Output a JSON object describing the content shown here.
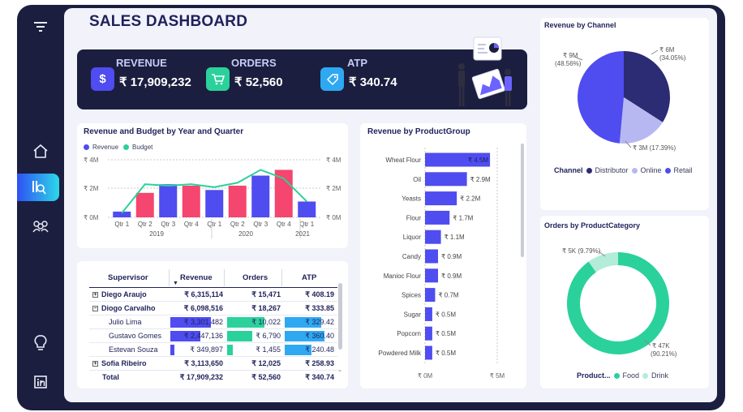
{
  "title": "SALES DASHBOARD",
  "sidebar": {
    "items": [
      {
        "name": "filter-icon",
        "glyph": "≡"
      },
      {
        "name": "home-icon",
        "glyph": "⌂"
      },
      {
        "name": "report-icon",
        "glyph": "▤"
      },
      {
        "name": "people-icon",
        "glyph": "⚇"
      },
      {
        "name": "lightbulb-icon",
        "glyph": "♁"
      },
      {
        "name": "linkedin-icon",
        "glyph": "in"
      }
    ]
  },
  "kpis": [
    {
      "label": "REVENUE",
      "value": "₹ 17,909,232",
      "icon": "dollar-icon",
      "glyph": "$",
      "color": "#4f4cf0"
    },
    {
      "label": "ORDERS",
      "value": "₹ 52,560",
      "icon": "cart-icon",
      "glyph": "🛒",
      "color": "#2bd19b"
    },
    {
      "label": "ATP",
      "value": "₹ 340.74",
      "icon": "tag-icon",
      "glyph": "%",
      "color": "#2fa8f2"
    }
  ],
  "colors": {
    "revenue_bar": "#4f4cf0",
    "revenue_bar_alt": "#f4466e",
    "budget_line": "#2bd19b",
    "distributor": "#2b2c73",
    "online": "#b7b8f2",
    "retail": "#4f4cf0",
    "food": "#2bd19b",
    "drink": "#b3ecd9",
    "atp_bar": "#2fa8f2"
  },
  "revenue_budget": {
    "title": "Revenue and Budget by Year and Quarter",
    "legend": [
      "Revenue",
      "Budget"
    ],
    "left_ticks": [
      "₹ 4M",
      "₹ 2M",
      "₹ 0M"
    ],
    "right_ticks": [
      "₹ 4M",
      "₹ 2M",
      "₹ 0M"
    ],
    "years": [
      "2019",
      "2020",
      "2021"
    ]
  },
  "chart_data": [
    {
      "type": "bar",
      "title": "Revenue and Budget by Year and Quarter",
      "categories": [
        "Qtr 1",
        "Qtr 2",
        "Qtr 3",
        "Qtr 4",
        "Qtr 1",
        "Qtr 2",
        "Qtr 3",
        "Qtr 4",
        "Qtr 1"
      ],
      "groups": [
        "2019",
        "2019",
        "2019",
        "2019",
        "2020",
        "2020",
        "2020",
        "2020",
        "2021"
      ],
      "series": [
        {
          "name": "Revenue",
          "values": [
            0.4,
            1.7,
            2.3,
            2.2,
            1.9,
            2.2,
            2.9,
            3.3,
            1.1
          ]
        },
        {
          "name": "Budget",
          "values": [
            0.3,
            2.3,
            2.2,
            2.3,
            2.1,
            2.4,
            3.3,
            2.7,
            1.1
          ]
        }
      ],
      "ylim": [
        0,
        4
      ],
      "y_unit": "₹ M"
    },
    {
      "type": "bar",
      "title": "Revenue by ProductGroup",
      "categories": [
        "Wheat Flour",
        "Oil",
        "Yeasts",
        "Flour",
        "Liquor",
        "Candy",
        "Manioc Flour",
        "Spices",
        "Sugar",
        "Popcorn",
        "Powdered Milk"
      ],
      "values": [
        4.5,
        2.9,
        2.2,
        1.7,
        1.1,
        0.9,
        0.9,
        0.7,
        0.5,
        0.5,
        0.5
      ],
      "value_labels": [
        "₹ 4.5M",
        "₹ 2.9M",
        "₹ 2.2M",
        "₹ 1.7M",
        "₹ 1.1M",
        "₹ 0.9M",
        "₹ 0.9M",
        "₹ 0.7M",
        "₹ 0.5M",
        "₹ 0.5M",
        "₹ 0.5M"
      ],
      "x_ticks": [
        "₹ 0M",
        "₹ 5M"
      ],
      "xlim": [
        0,
        5
      ],
      "orientation": "horizontal"
    },
    {
      "type": "pie",
      "title": "Revenue by Channel",
      "labels": [
        "Distributor",
        "Online",
        "Retail"
      ],
      "values": [
        34.05,
        17.39,
        48.56
      ],
      "value_labels": [
        "₹ 6M\n(34.05%)",
        "₹ 3M (17.39%)",
        "₹ 9M\n(48.56%)"
      ],
      "legend_title": "Channel"
    },
    {
      "type": "pie",
      "title": "Orders by ProductCategory",
      "donut": true,
      "labels": [
        "Food",
        "Drink"
      ],
      "values": [
        90.21,
        9.79
      ],
      "value_labels": [
        "₹ 47K\n(90.21%)",
        "₹ 5K (9.79%)"
      ],
      "legend_title": "Product..."
    }
  ],
  "product_group": {
    "title": "Revenue by ProductGroup"
  },
  "channel": {
    "title": "Revenue by Channel",
    "legend_title": "Channel",
    "labels": [
      "Distributor",
      "Online",
      "Retail"
    ],
    "label_distributor_1": "₹ 6M",
    "label_distributor_2": "(34.05%)",
    "label_online": "₹ 3M (17.39%)",
    "label_retail_1": "₹ 9M",
    "label_retail_2": "(48.56%)"
  },
  "category": {
    "title": "Orders by ProductCategory",
    "legend_title": "Product...",
    "labels": [
      "Food",
      "Drink"
    ],
    "label_food_1": "₹ 47K",
    "label_food_2": "(90.21%)",
    "label_drink": "₹ 5K (9.79%)"
  },
  "table": {
    "headers": [
      "Supervisor",
      "Revenue",
      "Orders",
      "ATP"
    ],
    "rows": [
      {
        "supervisor": "Diego Araujo",
        "revenue": "₹ 6,315,114",
        "orders": "₹ 15,471",
        "atp": "₹ 408.19",
        "level": 0,
        "expander": "+"
      },
      {
        "supervisor": "Diogo Carvalho",
        "revenue": "₹ 6,098,516",
        "orders": "₹ 18,267",
        "atp": "₹ 333.85",
        "level": 0,
        "expander": "−"
      },
      {
        "supervisor": "Julio Lima",
        "revenue": "₹ 3,301,482",
        "orders": "₹ 10,022",
        "atp": "₹ 329.42",
        "level": 1,
        "rev_bar": 0.76,
        "ord_bar": 0.68,
        "atp_bar": 0.8
      },
      {
        "supervisor": "Gustavo Gomes",
        "revenue": "₹ 2,447,136",
        "orders": "₹ 6,790",
        "atp": "₹ 360.40",
        "level": 1,
        "rev_bar": 0.56,
        "ord_bar": 0.47,
        "atp_bar": 0.88
      },
      {
        "supervisor": "Estevan Souza",
        "revenue": "₹ 349,897",
        "orders": "₹ 1,455",
        "atp": "₹ 240.48",
        "level": 1,
        "rev_bar": 0.08,
        "ord_bar": 0.1,
        "atp_bar": 0.59
      },
      {
        "supervisor": "Sofia Ribeiro",
        "revenue": "₹ 3,113,650",
        "orders": "₹ 12,025",
        "atp": "₹ 258.93",
        "level": 0,
        "expander": "+"
      }
    ],
    "total": {
      "supervisor": "Total",
      "revenue": "₹ 17,909,232",
      "orders": "₹ 52,560",
      "atp": "₹ 340.74"
    }
  }
}
